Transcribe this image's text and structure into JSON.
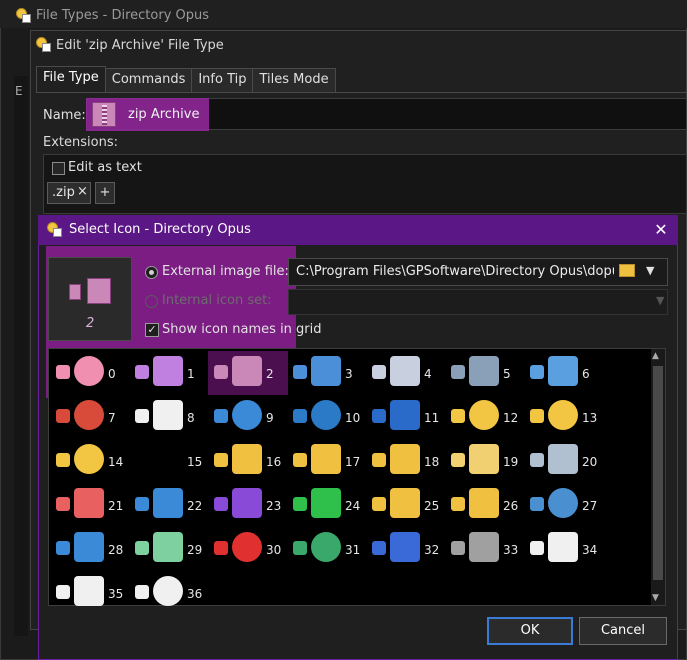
{
  "background_window": {
    "title": "File Types - Directory Opus",
    "partial_label": "E"
  },
  "edit_dialog": {
    "title": "Edit 'zip Archive' File Type",
    "tabs": [
      {
        "label": "File Type",
        "active": true
      },
      {
        "label": "Commands",
        "active": false
      },
      {
        "label": "Info Tip",
        "active": false
      },
      {
        "label": "Tiles Mode",
        "active": false
      }
    ],
    "name_label": "Name:",
    "name_value": "zip Archive",
    "extensions_label": "Extensions:",
    "edit_as_text_label": "Edit as text",
    "extension_chips": [
      ".zip"
    ],
    "chip_remove_glyph": "×",
    "add_extension_glyph": "+"
  },
  "select_icon_dialog": {
    "title": "Select Icon - Directory Opus",
    "close_glyph": "✕",
    "preview_index": "2",
    "external_image_label": "External image file:",
    "external_image_path": "C:\\Program Files\\GPSoftware\\Directory Opus\\dopus",
    "internal_icon_set_label": "Internal icon set:",
    "show_icon_names_label": "Show icon names in grid",
    "show_icon_names_checked": true,
    "check_glyph": "✓",
    "icons": [
      {
        "index": "0",
        "name": "app-badge-icon",
        "color": "#f08fb0",
        "selected": false
      },
      {
        "index": "1",
        "name": "magnifier-icon",
        "color": "#c080e0",
        "selected": false
      },
      {
        "index": "2",
        "name": "zip-archive-icon",
        "color": "#c988b8",
        "selected": true
      },
      {
        "index": "3",
        "name": "window-app-icon",
        "color": "#4a8fd8",
        "selected": false
      },
      {
        "index": "4",
        "name": "window-dots-icon",
        "color": "#c8d0e0",
        "selected": false
      },
      {
        "index": "5",
        "name": "search-icon",
        "color": "#8aa0b8",
        "selected": false
      },
      {
        "index": "6",
        "name": "copy-pages-icon",
        "color": "#5aa0e0",
        "selected": false
      },
      {
        "index": "7",
        "name": "window-error-icon",
        "color": "#d84a3a",
        "selected": false
      },
      {
        "index": "8",
        "name": "blank-window-icon",
        "color": "#f0f0f0",
        "selected": false
      },
      {
        "index": "9",
        "name": "network-globe-icon",
        "color": "#3a8ad8",
        "selected": false
      },
      {
        "index": "10",
        "name": "globe-lock-icon",
        "color": "#2a7ac8",
        "selected": false
      },
      {
        "index": "11",
        "name": "window-blue-icon",
        "color": "#2a6ac8",
        "selected": false
      },
      {
        "index": "12",
        "name": "app-badge-yellow-icon",
        "color": "#f2c542",
        "selected": false
      },
      {
        "index": "13",
        "name": "app-badge-large-icon",
        "color": "#f2c542",
        "selected": false
      },
      {
        "index": "14",
        "name": "app-badge-alt-icon",
        "color": "#f2c542",
        "selected": false
      },
      {
        "index": "15",
        "name": "empty-icon",
        "color": "#000000",
        "selected": false
      },
      {
        "index": "16",
        "name": "star-document-icon",
        "color": "#f0c040",
        "selected": false
      },
      {
        "index": "17",
        "name": "star-document-alt-icon",
        "color": "#f0c040",
        "selected": false
      },
      {
        "index": "18",
        "name": "folder-icon",
        "color": "#f0c040",
        "selected": false
      },
      {
        "index": "19",
        "name": "folder-document-icon",
        "color": "#f0d070",
        "selected": false
      },
      {
        "index": "20",
        "name": "server-icon",
        "color": "#b0c0d0",
        "selected": false
      },
      {
        "index": "21",
        "name": "music-icon",
        "color": "#e86060",
        "selected": false
      },
      {
        "index": "22",
        "name": "picture-icon",
        "color": "#3a8ad8",
        "selected": false
      },
      {
        "index": "23",
        "name": "video-icon",
        "color": "#8a4ad8",
        "selected": false
      },
      {
        "index": "24",
        "name": "green-up-arrow-icon",
        "color": "#2ec04a",
        "selected": false
      },
      {
        "index": "25",
        "name": "document-check-icon",
        "color": "#f0c040",
        "selected": false
      },
      {
        "index": "26",
        "name": "document-search-icon",
        "color": "#f0c040",
        "selected": false
      },
      {
        "index": "27",
        "name": "gear-check-icon",
        "color": "#4a90d0",
        "selected": false
      },
      {
        "index": "28",
        "name": "device-icon",
        "color": "#3a8ad8",
        "selected": false
      },
      {
        "index": "29",
        "name": "plus-icon",
        "color": "#7fd0a0",
        "selected": false
      },
      {
        "index": "30",
        "name": "error-icon",
        "color": "#e03030",
        "selected": false
      },
      {
        "index": "31",
        "name": "check-circle-icon",
        "color": "#3aa86a",
        "selected": false
      },
      {
        "index": "32",
        "name": "flag-icon",
        "color": "#3a6ad8",
        "selected": false
      },
      {
        "index": "33",
        "name": "pin-icon",
        "color": "#a0a0a0",
        "selected": false
      },
      {
        "index": "34",
        "name": "blank-page-icon",
        "color": "#f0f0f0",
        "selected": false
      },
      {
        "index": "35",
        "name": "film-reel-icon",
        "color": "#f0f0f0",
        "selected": false
      },
      {
        "index": "36",
        "name": "cloud-icon",
        "color": "#f0f0f0",
        "selected": false
      }
    ],
    "ok_label": "OK",
    "cancel_label": "Cancel"
  },
  "colors": {
    "highlight": "#961ea0",
    "dialog_accent": "#5a1785",
    "ok_border": "#3a7bd5"
  }
}
